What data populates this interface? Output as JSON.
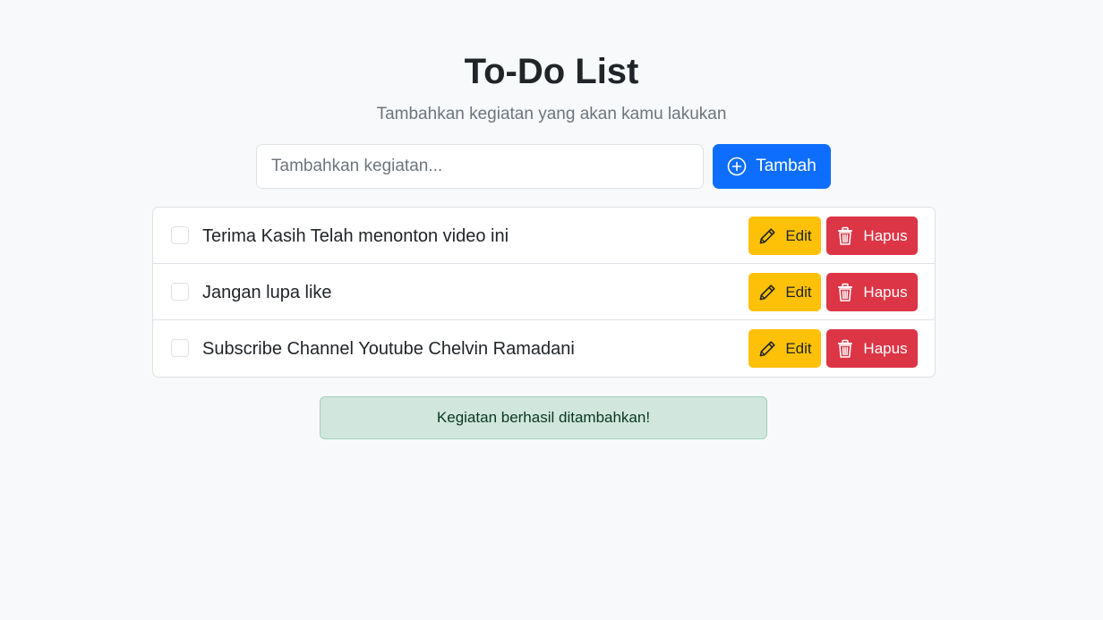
{
  "header": {
    "title": "To-Do List",
    "subtitle": "Tambahkan kegiatan yang akan kamu lakukan"
  },
  "add_form": {
    "input_value": "",
    "input_placeholder": "Tambahkan kegiatan...",
    "button_label": "Tambah",
    "button_icon": "plus-circle-icon"
  },
  "todos": [
    {
      "text": "Terima Kasih Telah menonton video ini",
      "done": false
    },
    {
      "text": "Jangan lupa like",
      "done": false
    },
    {
      "text": "Subscribe Channel Youtube Chelvin Ramadani",
      "done": false
    }
  ],
  "actions": {
    "edit_label": "Edit",
    "edit_icon": "pencil-icon",
    "delete_label": "Hapus",
    "delete_icon": "trash-icon"
  },
  "alert": {
    "message": "Kegiatan berhasil ditambahkan!"
  },
  "colors": {
    "primary": "#0d6efd",
    "warning": "#ffc107",
    "danger": "#dc3545",
    "success_bg": "#d1e7dd",
    "success_text": "#0a3622",
    "page_bg": "#f8f9fa"
  }
}
